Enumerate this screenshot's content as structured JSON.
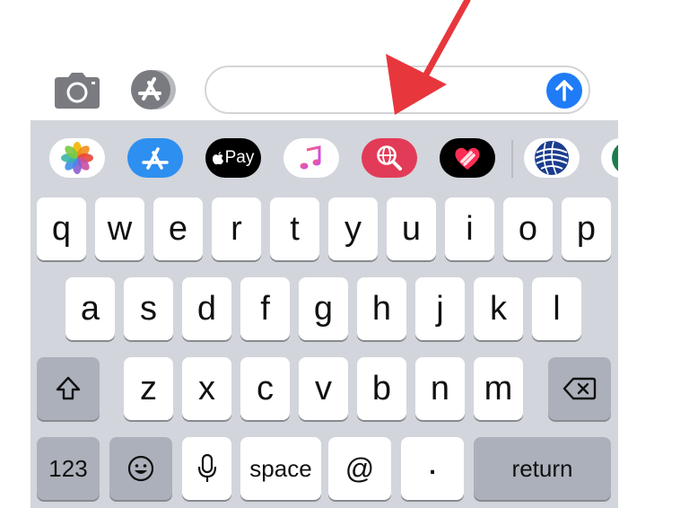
{
  "toolbar": {
    "camera_icon": "camera-icon",
    "appstore_icon": "app-store-icon",
    "message_input": {
      "value": "",
      "placeholder": ""
    },
    "send_icon": "arrow-up-icon",
    "colors": {
      "send": "#1f7cf6",
      "annotation_arrow": "#e8363d"
    }
  },
  "app_drawer": {
    "apps": [
      {
        "name": "photos",
        "icon": "photos-icon"
      },
      {
        "name": "app-store",
        "icon": "app-store-icon"
      },
      {
        "name": "apple-pay",
        "icon": "apple-pay-icon",
        "label": "Pay"
      },
      {
        "name": "music",
        "icon": "music-note-icon"
      },
      {
        "name": "images-search",
        "icon": "globe-search-icon"
      },
      {
        "name": "digital-touch",
        "icon": "heart-icon"
      },
      {
        "name": "united",
        "icon": "united-globe-icon"
      },
      {
        "name": "partial-app",
        "icon": "green-app-icon"
      }
    ]
  },
  "keyboard": {
    "row1": [
      "q",
      "w",
      "e",
      "r",
      "t",
      "y",
      "u",
      "i",
      "o",
      "p"
    ],
    "row2": [
      "a",
      "s",
      "d",
      "f",
      "g",
      "h",
      "j",
      "k",
      "l"
    ],
    "row3": [
      "z",
      "x",
      "c",
      "v",
      "b",
      "n",
      "m"
    ],
    "row4": {
      "numbers": "123",
      "emoji_icon": "emoji-icon",
      "dictation_icon": "microphone-icon",
      "space": "space",
      "at": "@",
      "period": ".",
      "return": "return"
    },
    "shift_icon": "shift-icon",
    "delete_icon": "delete-icon"
  }
}
